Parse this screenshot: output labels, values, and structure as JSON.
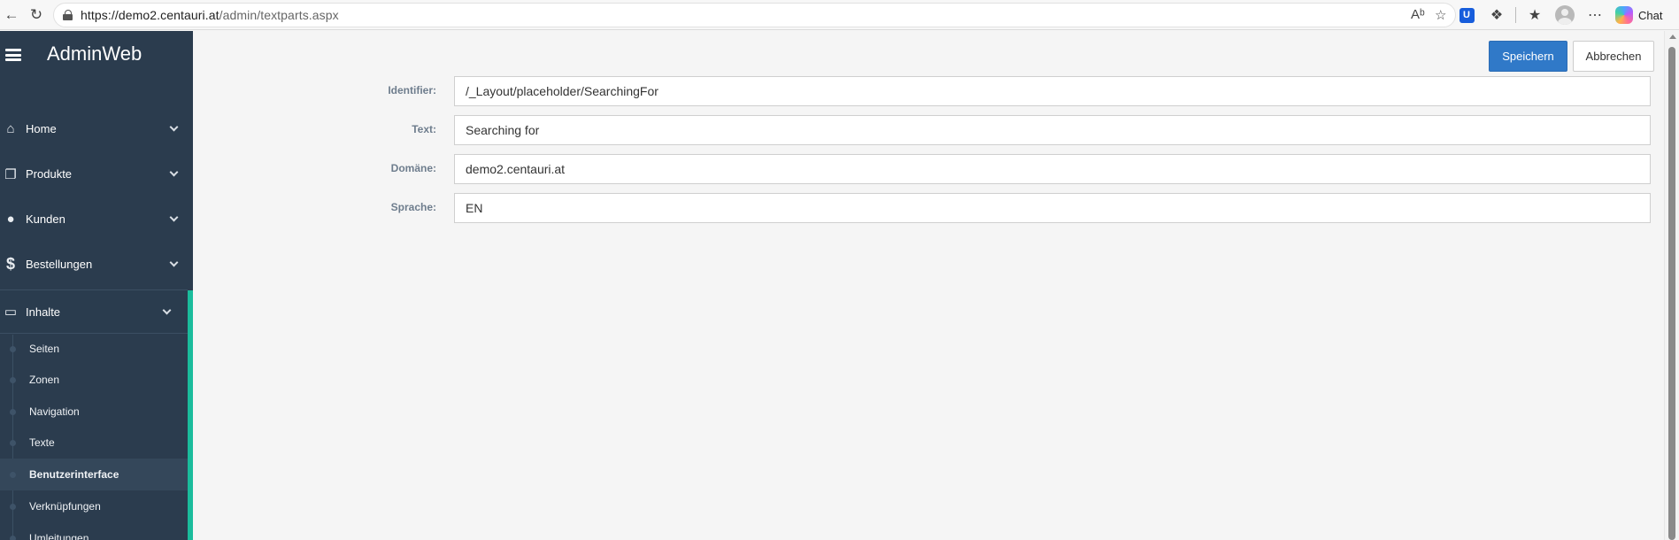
{
  "browser": {
    "url_host": "https://demo2.centauri.at",
    "url_path": "/admin/textparts.aspx",
    "chat_label": "Chat",
    "bitwarden_letter": "U"
  },
  "sidebar": {
    "brand": "AdminWeb",
    "menu": [
      {
        "label": "Home",
        "icon": "home-icon"
      },
      {
        "label": "Produkte",
        "icon": "cube-icon"
      },
      {
        "label": "Kunden",
        "icon": "user-icon"
      },
      {
        "label": "Bestellungen",
        "icon": "dollar-icon"
      },
      {
        "label": "Inhalte",
        "icon": "monitor-icon"
      }
    ],
    "submenu": [
      {
        "label": "Seiten"
      },
      {
        "label": "Zonen"
      },
      {
        "label": "Navigation"
      },
      {
        "label": "Texte"
      },
      {
        "label": "Benutzerinterface",
        "active": true
      },
      {
        "label": "Verknüpfungen"
      },
      {
        "label": "Umleitungen"
      }
    ],
    "accent_color": "#1abc9c"
  },
  "toolbar": {
    "save_label": "Speichern",
    "cancel_label": "Abbrechen"
  },
  "form": {
    "fields": [
      {
        "label": "Identifier:",
        "value": "/_Layout/placeholder/SearchingFor"
      },
      {
        "label": "Text:",
        "value": "Searching for"
      },
      {
        "label": "Domäne:",
        "value": "demo2.centauri.at"
      },
      {
        "label": "Sprache:",
        "value": "EN"
      }
    ]
  },
  "colors": {
    "sidebar_bg": "#2b3c4e",
    "primary_button": "#3079c8"
  }
}
